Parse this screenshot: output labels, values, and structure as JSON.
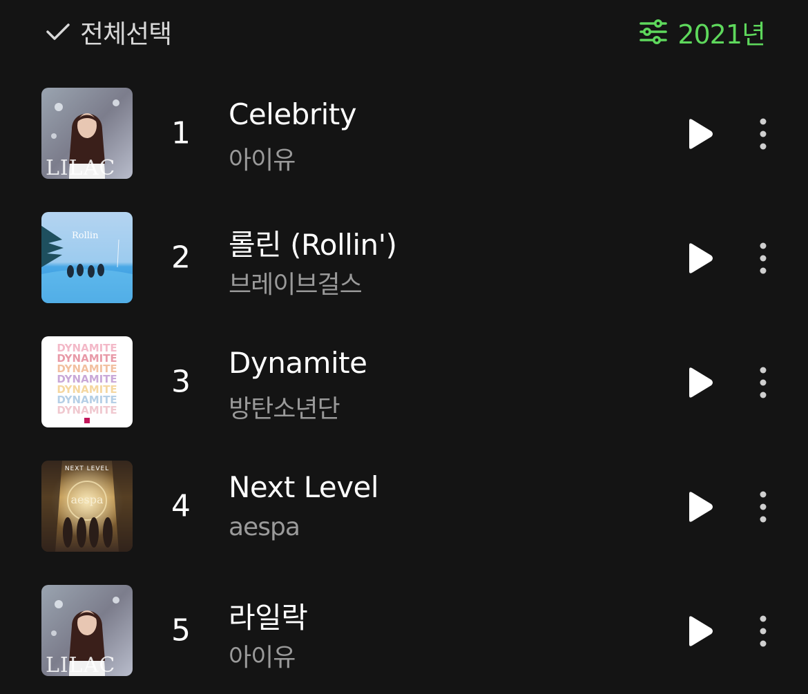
{
  "header": {
    "select_all_label": "전체선택",
    "year_label": "2021년",
    "accent_color": "#5ed85c"
  },
  "tracks": [
    {
      "rank": "1",
      "title": "Celebrity",
      "artist": "아이유",
      "cover": "lilac-album-cover"
    },
    {
      "rank": "2",
      "title": "롤린 (Rollin')",
      "artist": "브레이브걸스",
      "cover": "rollin-album-cover"
    },
    {
      "rank": "3",
      "title": "Dynamite",
      "artist": "방탄소년단",
      "cover": "dynamite-album-cover"
    },
    {
      "rank": "4",
      "title": "Next Level",
      "artist": "aespa",
      "cover": "next-level-album-cover"
    },
    {
      "rank": "5",
      "title": "라일락",
      "artist": "아이유",
      "cover": "lilac-album-cover"
    }
  ],
  "cover_text": {
    "lilac": "LILAC",
    "rollin": "Rollin",
    "dynamite": "DYNAMITE",
    "next_level": "NEXT LEVEL",
    "aespa": "aespa"
  },
  "icons": {
    "select_all": "check-icon",
    "filter": "sliders-icon",
    "play": "play-icon",
    "more": "more-vertical-icon"
  }
}
